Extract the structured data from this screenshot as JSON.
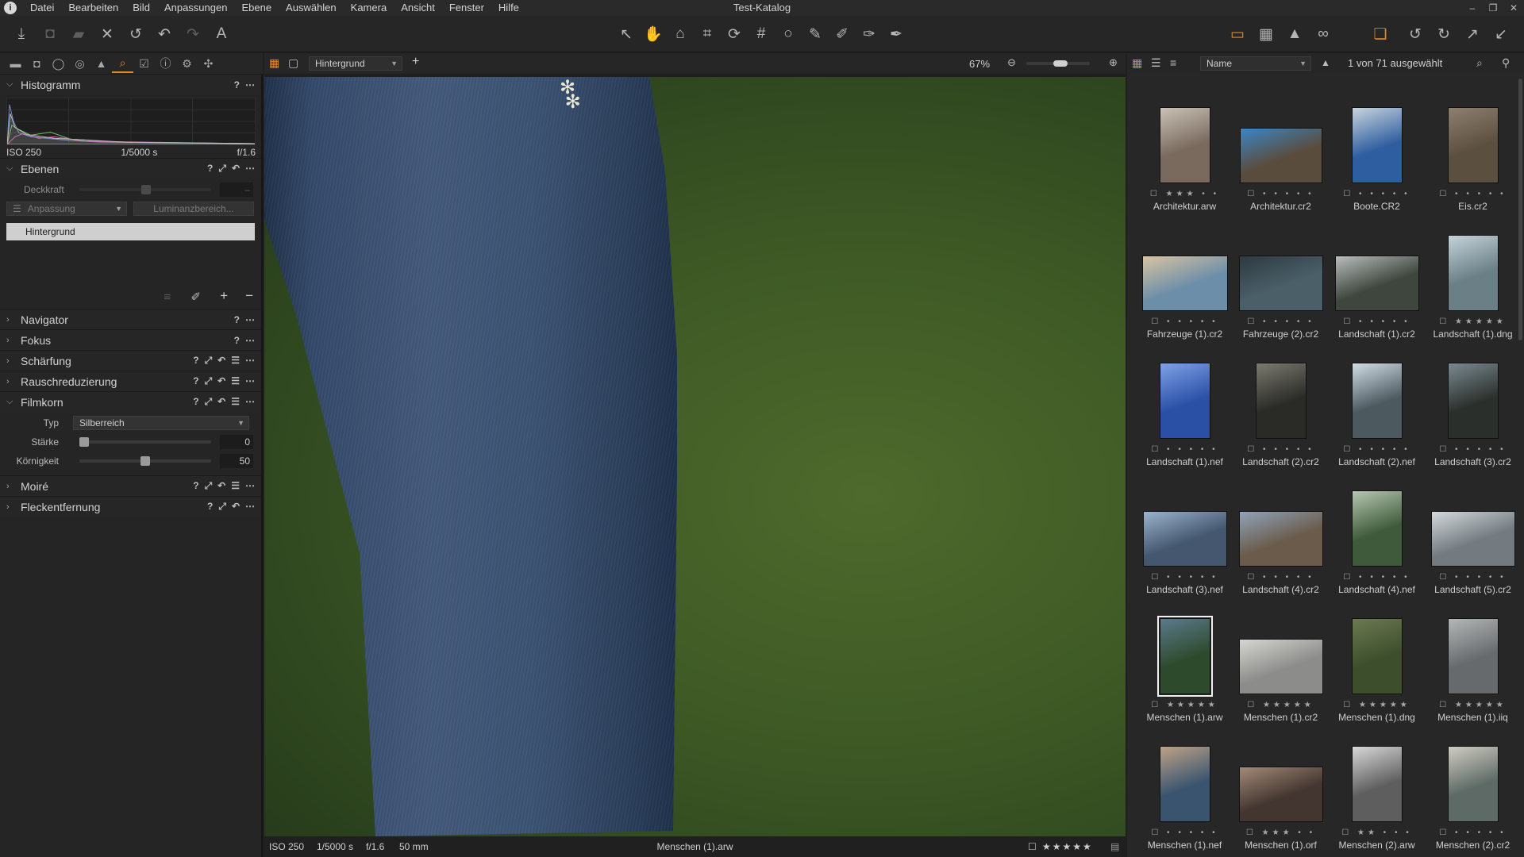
{
  "window_title": "Test-Katalog",
  "menu": [
    "Datei",
    "Bearbeiten",
    "Bild",
    "Anpassungen",
    "Ebene",
    "Auswählen",
    "Kamera",
    "Ansicht",
    "Fenster",
    "Hilfe"
  ],
  "left_panel": {
    "histogram": {
      "title": "Histogramm",
      "iso": "ISO 250",
      "shutter": "1/5000 s",
      "aperture": "f/1.6"
    },
    "layers": {
      "title": "Ebenen",
      "opacity_label": "Deckkraft",
      "adjust_label": "Anpassung",
      "luminance_label": "Luminanzbereich...",
      "layer_name": "Hintergrund"
    },
    "sections": {
      "navigator": "Navigator",
      "focus": "Fokus",
      "sharpening": "Schärfung",
      "noise": "Rauschreduzierung",
      "grain": "Filmkorn",
      "moire": "Moiré",
      "spot": "Fleckentfernung"
    },
    "grain": {
      "type_label": "Typ",
      "type_value": "Silberreich",
      "strength_label": "Stärke",
      "strength_value": "0",
      "strength_fraction": 0.0,
      "granularity_label": "Körnigkeit",
      "granularity_value": "50",
      "granularity_fraction": 0.5
    }
  },
  "viewer": {
    "layer_select": "Hintergrund",
    "zoom": "67%",
    "status": {
      "iso": "ISO 250",
      "shutter": "1/5000 s",
      "aperture": "f/1.6",
      "focal": "50 mm",
      "filename": "Menschen (1).arw",
      "rating": "★★★★★"
    }
  },
  "browser": {
    "sort_label": "Name",
    "selection_count": "1 von 71 ausgewählt",
    "thumbnails": [
      {
        "name": "Architektur.arw",
        "stars": "☐ ★★★ • •",
        "color": "#7a6a5e",
        "alt": "#c9c2b6",
        "w": 64,
        "h": 96
      },
      {
        "name": "Architektur.cr2",
        "stars": "☐ • • • • •",
        "color": "#5a4c3c",
        "alt": "#3b86c6",
        "w": 104,
        "h": 70
      },
      {
        "name": "Boote.CR2",
        "stars": "☐ • • • • •",
        "color": "#2f5ea0",
        "alt": "#c9d4de",
        "w": 64,
        "h": 96
      },
      {
        "name": "Eis.cr2",
        "stars": "☐ • • • • •",
        "color": "#5b4f3f",
        "alt": "#8e8070",
        "w": 64,
        "h": 96
      },
      {
        "name": "Fahrzeuge (1).cr2",
        "stars": "☐ • • • • •",
        "color": "#6c8ea8",
        "alt": "#d8c4a2",
        "w": 108,
        "h": 70
      },
      {
        "name": "Fahrzeuge (2).cr2",
        "stars": "☐ • • • • •",
        "color": "#4b5f68",
        "alt": "#2d3a40",
        "w": 106,
        "h": 70
      },
      {
        "name": "Landschaft (1).cr2",
        "stars": "☐ • • • • •",
        "color": "#3e463d",
        "alt": "#b9bdbd",
        "w": 106,
        "h": 70
      },
      {
        "name": "Landschaft (1).dng",
        "stars": "☐ ★★★★★",
        "color": "#6a7f86",
        "alt": "#c5d3d9",
        "w": 64,
        "h": 96
      },
      {
        "name": "Landschaft (1).nef",
        "stars": "☐ • • • • •",
        "color": "#2a50a6",
        "alt": "#7fa1e6",
        "w": 64,
        "h": 96
      },
      {
        "name": "Landschaft (2).cr2",
        "stars": "☐ • • • • •",
        "color": "#2a2a27",
        "alt": "#7b7b70",
        "w": 64,
        "h": 96
      },
      {
        "name": "Landschaft (2).nef",
        "stars": "☐ • • • • •",
        "color": "#4c5a60",
        "alt": "#d1dde5",
        "w": 64,
        "h": 96
      },
      {
        "name": "Landschaft (3).cr2",
        "stars": "☐ • • • • •",
        "color": "#2b2f2b",
        "alt": "#7a8a90",
        "w": 64,
        "h": 96
      },
      {
        "name": "Landschaft (3).nef",
        "stars": "☐ • • • • •",
        "color": "#44576f",
        "alt": "#9bb3cc",
        "w": 106,
        "h": 70
      },
      {
        "name": "Landschaft (4).cr2",
        "stars": "☐ • • • • •",
        "color": "#6a5b4b",
        "alt": "#8fa3b8",
        "w": 106,
        "h": 70
      },
      {
        "name": "Landschaft (4).nef",
        "stars": "☐ • • • • •",
        "color": "#3f5a3a",
        "alt": "#b6c7b2",
        "w": 64,
        "h": 96
      },
      {
        "name": "Landschaft (5).cr2",
        "stars": "☐ • • • • •",
        "color": "#737b80",
        "alt": "#d3d8db",
        "w": 106,
        "h": 70
      },
      {
        "name": "Menschen (1).arw",
        "stars": "☐ ★★★★★",
        "color": "#2e4a2c",
        "alt": "#5b7a8c",
        "w": 64,
        "h": 96,
        "selected": true
      },
      {
        "name": "Menschen (1).cr2",
        "stars": "☐ ★★★★★",
        "color": "#8c8c8a",
        "alt": "#d6d6d2",
        "w": 106,
        "h": 70
      },
      {
        "name": "Menschen (1).dng",
        "stars": "☐ ★★★★★",
        "color": "#3d4e2c",
        "alt": "#6c7a52",
        "w": 64,
        "h": 96
      },
      {
        "name": "Menschen (1).iiq",
        "stars": "☐ ★★★★★",
        "color": "#666a6c",
        "alt": "#b4b7b8",
        "w": 64,
        "h": 96
      },
      {
        "name": "Menschen (1).nef",
        "stars": "☐ • • • • •",
        "color": "#3a5470",
        "alt": "#bea287",
        "w": 64,
        "h": 96
      },
      {
        "name": "Menschen (1).orf",
        "stars": "☐ ★★★ • •",
        "color": "#433630",
        "alt": "#a38a78",
        "w": 106,
        "h": 70
      },
      {
        "name": "Menschen (2).arw",
        "stars": "☐ ★★ • • •",
        "color": "#5e5e5e",
        "alt": "#d8d8d8",
        "w": 64,
        "h": 96
      },
      {
        "name": "Menschen (2).cr2",
        "stars": "☐ • • • • •",
        "color": "#5d6a66",
        "alt": "#d0ccc2",
        "w": 64,
        "h": 96
      }
    ]
  },
  "colors": {
    "accent": "#e0892b"
  }
}
